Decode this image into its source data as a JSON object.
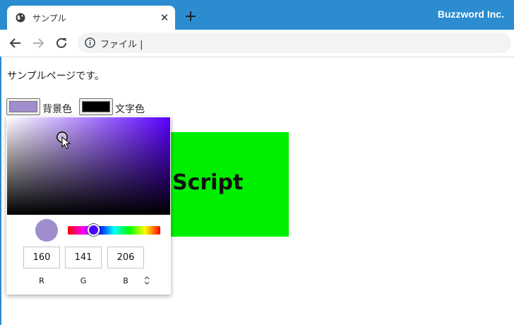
{
  "browser": {
    "tab_title": "サンプル",
    "brand": "Buzzword Inc.",
    "address": "ファイル |",
    "tabstrip_color": "#2b8ccf",
    "tab_close_icon": "close-icon",
    "new_tab_icon": "plus-icon"
  },
  "page": {
    "intro_text": "サンプルページです。",
    "background_color_label": "背景色",
    "text_color_label": "文字色",
    "background_swatch_color": "#a08dce",
    "text_swatch_color": "#000000",
    "box_text": "Script",
    "box_color": "#00ef00"
  },
  "picker": {
    "preview_color": "#a08dce",
    "hue_color": "#5a00ff",
    "r": "160",
    "g": "141",
    "b": "206",
    "r_label": "R",
    "g_label": "G",
    "b_label": "B",
    "format_toggle": "⌃⌄"
  }
}
